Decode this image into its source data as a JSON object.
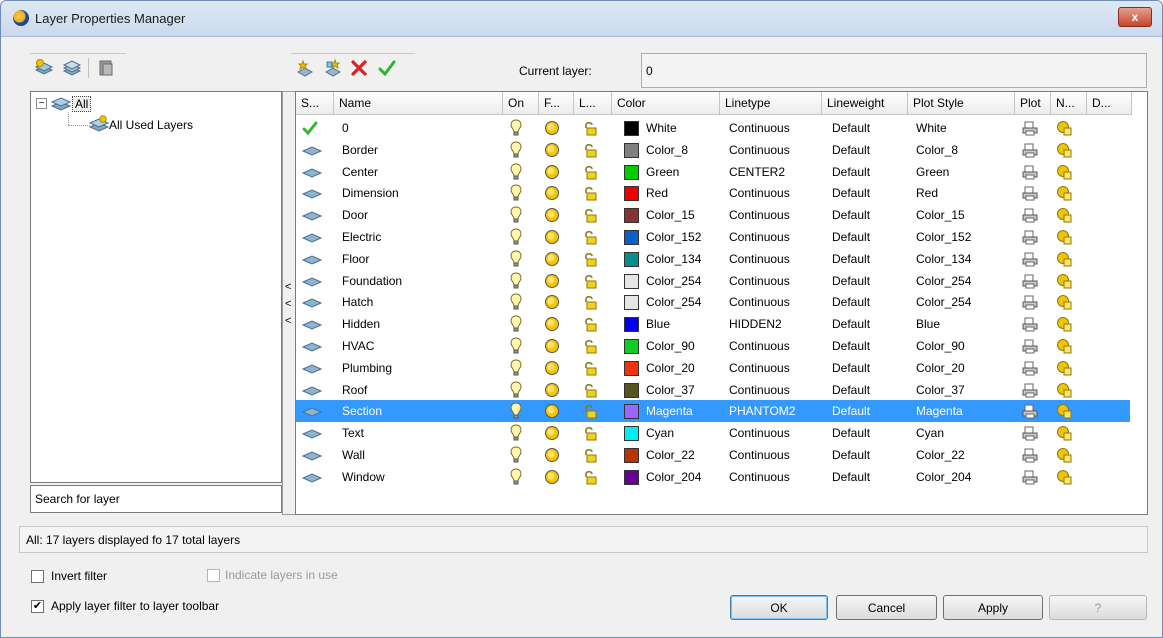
{
  "window": {
    "title": "Layer Properties Manager",
    "close_glyph": "x"
  },
  "toolbar": {
    "left_icons": [
      "new-property-filter-icon",
      "new-group-filter-icon",
      "layer-states-icon"
    ],
    "right_icons": [
      "new-layer-icon",
      "new-layer-vp-frozen-icon",
      "delete-layer-icon",
      "set-current-icon"
    ],
    "current_layer_label": "Current layer:",
    "current_layer_value": "0"
  },
  "tree": {
    "root": "All",
    "root_toggle": "−",
    "child": "All Used Layers"
  },
  "search": {
    "value": "Search for layer"
  },
  "splitter_arrows": [
    "<",
    "<",
    "<"
  ],
  "grid": {
    "headers": [
      "S...",
      "Name",
      "On",
      "F...",
      "L...",
      "Color",
      "Linetype",
      "Lineweight",
      "Plot Style",
      "Plot",
      "N...",
      "D..."
    ],
    "rows": [
      {
        "name": "0",
        "color": "White",
        "hex": "#000000",
        "linetype": "Continuous",
        "lineweight": "Default",
        "plotstyle": "White",
        "current": true
      },
      {
        "name": "Border",
        "color": "Color_8",
        "hex": "#808080",
        "linetype": "Continuous",
        "lineweight": "Default",
        "plotstyle": "Color_8"
      },
      {
        "name": "Center",
        "color": "Green",
        "hex": "#00cc00",
        "linetype": "CENTER2",
        "lineweight": "Default",
        "plotstyle": "Green"
      },
      {
        "name": "Dimension",
        "color": "Red",
        "hex": "#ee0000",
        "linetype": "Continuous",
        "lineweight": "Default",
        "plotstyle": "Red"
      },
      {
        "name": "Door",
        "color": "Color_15",
        "hex": "#883333",
        "linetype": "Continuous",
        "lineweight": "Default",
        "plotstyle": "Color_15"
      },
      {
        "name": "Electric",
        "color": "Color_152",
        "hex": "#0a5fc8",
        "linetype": "Continuous",
        "lineweight": "Default",
        "plotstyle": "Color_152"
      },
      {
        "name": "Floor",
        "color": "Color_134",
        "hex": "#0a8c8c",
        "linetype": "Continuous",
        "lineweight": "Default",
        "plotstyle": "Color_134"
      },
      {
        "name": "Foundation",
        "color": "Color_254",
        "hex": "#e6e6e6",
        "linetype": "Continuous",
        "lineweight": "Default",
        "plotstyle": "Color_254"
      },
      {
        "name": "Hatch",
        "color": "Color_254",
        "hex": "#e6e6e6",
        "linetype": "Continuous",
        "lineweight": "Default",
        "plotstyle": "Color_254"
      },
      {
        "name": "Hidden",
        "color": "Blue",
        "hex": "#0000ee",
        "linetype": "HIDDEN2",
        "lineweight": "Default",
        "plotstyle": "Blue"
      },
      {
        "name": "HVAC",
        "color": "Color_90",
        "hex": "#11cc22",
        "linetype": "Continuous",
        "lineweight": "Default",
        "plotstyle": "Color_90"
      },
      {
        "name": "Plumbing",
        "color": "Color_20",
        "hex": "#ee3311",
        "linetype": "Continuous",
        "lineweight": "Default",
        "plotstyle": "Color_20"
      },
      {
        "name": "Roof",
        "color": "Color_37",
        "hex": "#555522",
        "linetype": "Continuous",
        "lineweight": "Default",
        "plotstyle": "Color_37"
      },
      {
        "name": "Section",
        "color": "Magenta",
        "hex": "#9966ff",
        "linetype": "PHANTOM2",
        "lineweight": "Default",
        "plotstyle": "Magenta",
        "selected": true
      },
      {
        "name": "Text",
        "color": "Cyan",
        "hex": "#00eeee",
        "linetype": "Continuous",
        "lineweight": "Default",
        "plotstyle": "Cyan"
      },
      {
        "name": "Wall",
        "color": "Color_22",
        "hex": "#bb3300",
        "linetype": "Continuous",
        "lineweight": "Default",
        "plotstyle": "Color_22"
      },
      {
        "name": "Window",
        "color": "Color_204",
        "hex": "#660099",
        "linetype": "Continuous",
        "lineweight": "Default",
        "plotstyle": "Color_204"
      }
    ],
    "row_icons": {
      "status": "layer-sheet-icon",
      "on": "lightbulb-icon",
      "freeze": "sun-icon",
      "lock": "padlock-icon",
      "plot": "printer-icon",
      "new_vp_freeze": "new-vp-freeze-icon"
    }
  },
  "status_text": "All: 17 layers displayed fo 17 total layers",
  "options": {
    "invert_filter": {
      "label": "Invert filter",
      "checked": false
    },
    "indicate_in_use": {
      "label": "Indicate layers in use",
      "checked": false,
      "disabled": true
    },
    "apply_filter": {
      "label": "Apply layer filter to layer toolbar",
      "checked": true,
      "mark": "✔"
    }
  },
  "buttons": {
    "ok": "OK",
    "cancel": "Cancel",
    "apply": "Apply",
    "help": "?"
  },
  "colors": {
    "selection": "#3399ff",
    "current_check": "#2db52d",
    "delete_x": "#dd2020"
  }
}
